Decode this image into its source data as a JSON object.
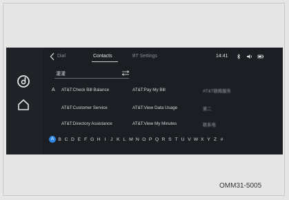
{
  "top_bar": {
    "tabs": [
      {
        "label": "Dial"
      },
      {
        "label": "Contacts"
      },
      {
        "label": "BT Settings"
      }
    ],
    "active_tab": "Contacts",
    "clock": "14:41"
  },
  "search": {
    "value": "灌灌"
  },
  "section": {
    "letter": "A"
  },
  "contacts": [
    {
      "name": "AT&T:Check Bill Balance"
    },
    {
      "name": "AT&T:Pay My Bill"
    },
    {
      "name": "AT&T联络服务"
    },
    {
      "name": "AT&T:Customer Service"
    },
    {
      "name": "AT&T:View Data Usage"
    },
    {
      "name": "第二"
    },
    {
      "name": "AT&T:Directory Assistance"
    },
    {
      "name": "AT&T:View My Minutes"
    },
    {
      "name": "联系电"
    }
  ],
  "alphabet": {
    "selected": "A",
    "letters": [
      "A",
      "B",
      "C",
      "D",
      "E",
      "F",
      "G",
      "H",
      "I",
      "J",
      "K",
      "L",
      "M",
      "N",
      "O",
      "P",
      "Q",
      "R",
      "S",
      "T",
      "U",
      "V",
      "W",
      "X",
      "Y",
      "Z",
      "#"
    ]
  },
  "caption": "OMM31-5005",
  "colors": {
    "accent": "#2e86e6",
    "screen_bg": "#1b1e23"
  },
  "icons": {
    "rail": [
      "music-disc-icon",
      "home-icon"
    ],
    "status": [
      "bluetooth-icon",
      "volume-icon",
      "battery-icon"
    ]
  }
}
